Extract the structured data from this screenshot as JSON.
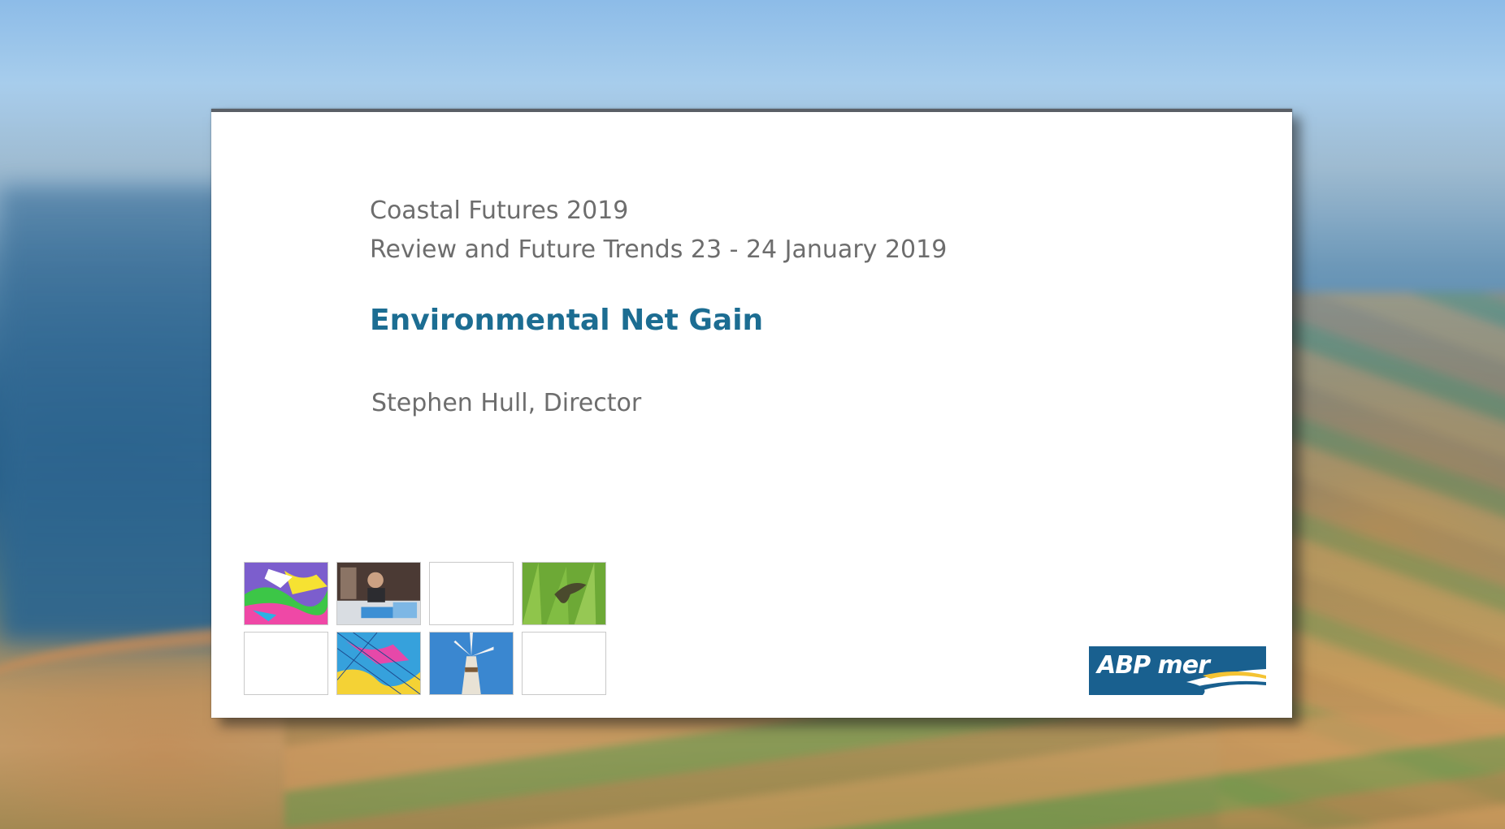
{
  "slide": {
    "event_line": "Coastal Futures 2019",
    "subtitle_line": "Review and Future Trends 23 - 24 January 2019",
    "title": "Environmental Net Gain",
    "presenter": "Stephen Hull, Director"
  },
  "logo": {
    "text": "ABP mer",
    "background_color": "#1c5f8c",
    "accent_color": "#ffffff"
  },
  "colors": {
    "title": "#1f6c90",
    "body_text": "#6d6d6d",
    "slide_background": "#ffffff"
  },
  "tiles": [
    {
      "icon": "model-map-image"
    },
    {
      "icon": "laboratory-image"
    },
    {
      "icon": "blank-tile"
    },
    {
      "icon": "seagrass-seahorse-image"
    },
    {
      "icon": "blank-tile"
    },
    {
      "icon": "chart-map-image"
    },
    {
      "icon": "wind-turbine-image"
    },
    {
      "icon": "blank-tile"
    }
  ]
}
